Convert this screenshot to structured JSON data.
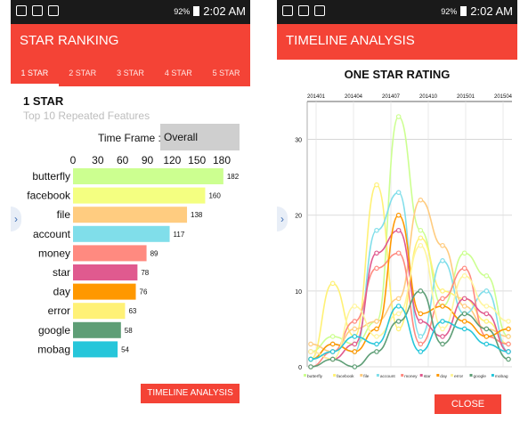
{
  "left_screen": {
    "status": {
      "notify": "92%",
      "time": "2:02 AM"
    },
    "app_title": "STAR RANKING",
    "tabs": [
      "1 STAR",
      "2 STAR",
      "3 STAR",
      "4 STAR",
      "5 STAR"
    ],
    "active_tab": 0,
    "heading": "1 STAR",
    "subheading": "Top 10 Repeated Features",
    "time_frame_label": "Time Frame :",
    "time_frame_value": "Overall",
    "button_label": "TIMELINE ANALYSIS"
  },
  "right_screen": {
    "status": {
      "notify": "92%",
      "time": "2:02 AM"
    },
    "app_title": "TIMELINE ANALYSIS",
    "close_label": "CLOSE"
  },
  "colors": {
    "accent": "#f44336"
  },
  "chart_data": [
    {
      "type": "bar",
      "orientation": "horizontal",
      "categories": [
        "butterfly",
        "facebook",
        "file",
        "account",
        "money",
        "star",
        "day",
        "error",
        "google",
        "mobag"
      ],
      "values": [
        182,
        160,
        138,
        117,
        89,
        78,
        76,
        63,
        58,
        54
      ],
      "colors": [
        "#ccff90",
        "#f4ff81",
        "#ffcc80",
        "#80deea",
        "#ff8a80",
        "#e05a8f",
        "#ff9800",
        "#fff176",
        "#5e9e76",
        "#26c6da"
      ],
      "xlim": [
        0,
        180
      ],
      "xticks": [
        0,
        30,
        60,
        90,
        120,
        150,
        180
      ]
    },
    {
      "type": "line",
      "title": "ONE STAR RATING",
      "x": [
        "201401",
        "201404",
        "201407",
        "201410",
        "201501",
        "201504"
      ],
      "ylim": [
        0,
        35
      ],
      "yticks": [
        0,
        10,
        20,
        30
      ],
      "series": [
        {
          "name": "butterfly",
          "color": "#ccff90",
          "values": [
            2,
            4,
            3,
            6,
            33,
            18,
            8,
            15,
            12,
            4
          ]
        },
        {
          "name": "facebook",
          "color": "#fff176",
          "values": [
            1,
            11,
            4,
            24,
            5,
            17,
            10,
            9,
            6,
            3
          ]
        },
        {
          "name": "file",
          "color": "#ffcc80",
          "values": [
            3,
            2,
            5,
            6,
            9,
            22,
            16,
            8,
            5,
            4
          ]
        },
        {
          "name": "account",
          "color": "#80deea",
          "values": [
            1,
            3,
            2,
            18,
            23,
            4,
            14,
            7,
            10,
            2
          ]
        },
        {
          "name": "money",
          "color": "#ff8a80",
          "values": [
            0,
            2,
            6,
            13,
            15,
            3,
            9,
            13,
            4,
            3
          ]
        },
        {
          "name": "star",
          "color": "#e05a8f",
          "values": [
            2,
            1,
            3,
            15,
            18,
            6,
            4,
            9,
            7,
            2
          ]
        },
        {
          "name": "day",
          "color": "#ff9800",
          "values": [
            1,
            3,
            2,
            5,
            20,
            7,
            8,
            6,
            4,
            5
          ]
        },
        {
          "name": "error",
          "color": "#fff59d",
          "values": [
            2,
            1,
            8,
            4,
            7,
            16,
            5,
            12,
            8,
            6
          ]
        },
        {
          "name": "google",
          "color": "#5e9e76",
          "values": [
            0,
            1,
            0,
            2,
            6,
            10,
            3,
            7,
            5,
            1
          ]
        },
        {
          "name": "mobag",
          "color": "#26c6da",
          "values": [
            1,
            2,
            4,
            3,
            8,
            2,
            6,
            5,
            3,
            2
          ]
        }
      ]
    }
  ]
}
